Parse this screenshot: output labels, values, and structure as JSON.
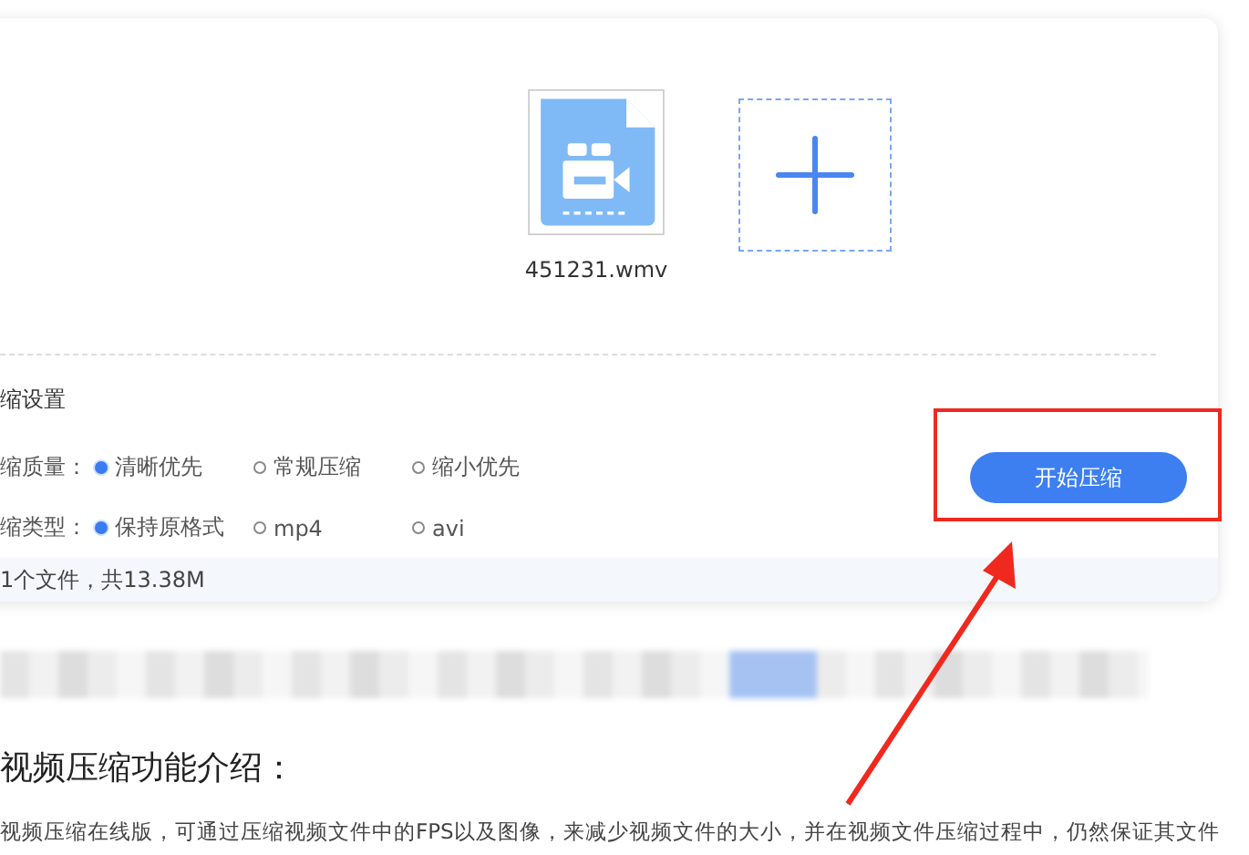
{
  "upload": {
    "file_name": "451231.wmv"
  },
  "settings": {
    "title": "缩设置",
    "rows": [
      {
        "label": "缩质量：",
        "options": [
          {
            "label": "清晰优先",
            "selected": true
          },
          {
            "label": "常规压缩",
            "selected": false
          },
          {
            "label": "缩小优先",
            "selected": false
          }
        ]
      },
      {
        "label": "缩类型：",
        "options": [
          {
            "label": "保持原格式",
            "selected": true
          },
          {
            "label": "mp4",
            "selected": false
          },
          {
            "label": "avi",
            "selected": false
          }
        ]
      }
    ]
  },
  "start_button": "开始压缩",
  "footer": "1个文件，共13.38M",
  "article": {
    "heading": "视频压缩功能介绍：",
    "paragraph": "视频压缩在线版，可通过压缩视频文件中的FPS以及图像，来减少视频文件的大小，并在视频文件压缩过程中，仍然保证其文件"
  }
}
